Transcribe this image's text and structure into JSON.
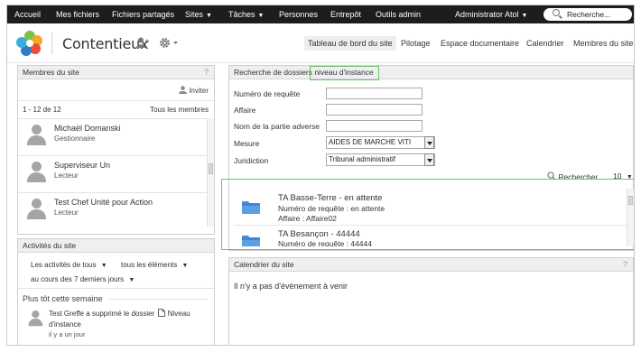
{
  "topbar": {
    "items": [
      "Accueil",
      "Mes fichiers",
      "Fichiers partagés",
      "Sites",
      "Tâches",
      "Personnes",
      "Entrepôt",
      "Outils admin"
    ],
    "user": "Administrator Atol",
    "search_placeholder": "Recherche...",
    "background": "#1d1d1d"
  },
  "header": {
    "site_title": "Contentieux",
    "nav": [
      "Tableau de bord du site",
      "Pilotage",
      "Espace documentaire",
      "Calendrier",
      "Membres du site"
    ]
  },
  "members": {
    "title": "Membres du site",
    "help": "?",
    "invite": "Inviter",
    "range": "1 - 12 de 12",
    "all": "Tous les membres",
    "list": [
      {
        "name": "Michaël Domanski",
        "role": "Gestionnaire"
      },
      {
        "name": "Superviseur Un",
        "role": "Lecteur"
      },
      {
        "name": "Test Chef Unité pour Action",
        "role": "Lecteur"
      }
    ]
  },
  "activities": {
    "title": "Activités du site",
    "filter1": "Les activités de tous",
    "filter2": "tous les éléments",
    "filter3": "au cours des 7 derniers jours",
    "section": "Plus tôt cette semaine",
    "entry_text": "Test Greffe a supprimé le dossier",
    "entry_doc": "Niveau d'instance",
    "entry_time": "il y a un jour"
  },
  "search": {
    "title_prefix": "Recherche de dossiers",
    "title_highlight": "niveau d'instance",
    "fields": {
      "numero": "Numéro de requête",
      "affaire": "Affaire",
      "partie": "Nom de la partie adverse",
      "mesure": "Mesure",
      "juridiction": "Juridiction"
    },
    "mesure_value": "AIDES DE MARCHE VITI",
    "juridiction_value": "Tribunal administratif",
    "search_label": "Rechercher",
    "page_size": "10",
    "results": [
      {
        "title": "TA Basse-Terre - en attente",
        "line1": "Numéro de requête : en attente",
        "line2": "Affaire : Affaire02"
      },
      {
        "title": "TA Besançon - 44444",
        "line1": "Numéro de requête : 44444",
        "line2": ""
      }
    ]
  },
  "calendar": {
    "title": "Calendrier du site",
    "help": "?",
    "empty": "Il n'y a pas d'événement à venir"
  },
  "colors": {
    "highlight": "#6cc36c",
    "folder": "#3d85d8"
  }
}
